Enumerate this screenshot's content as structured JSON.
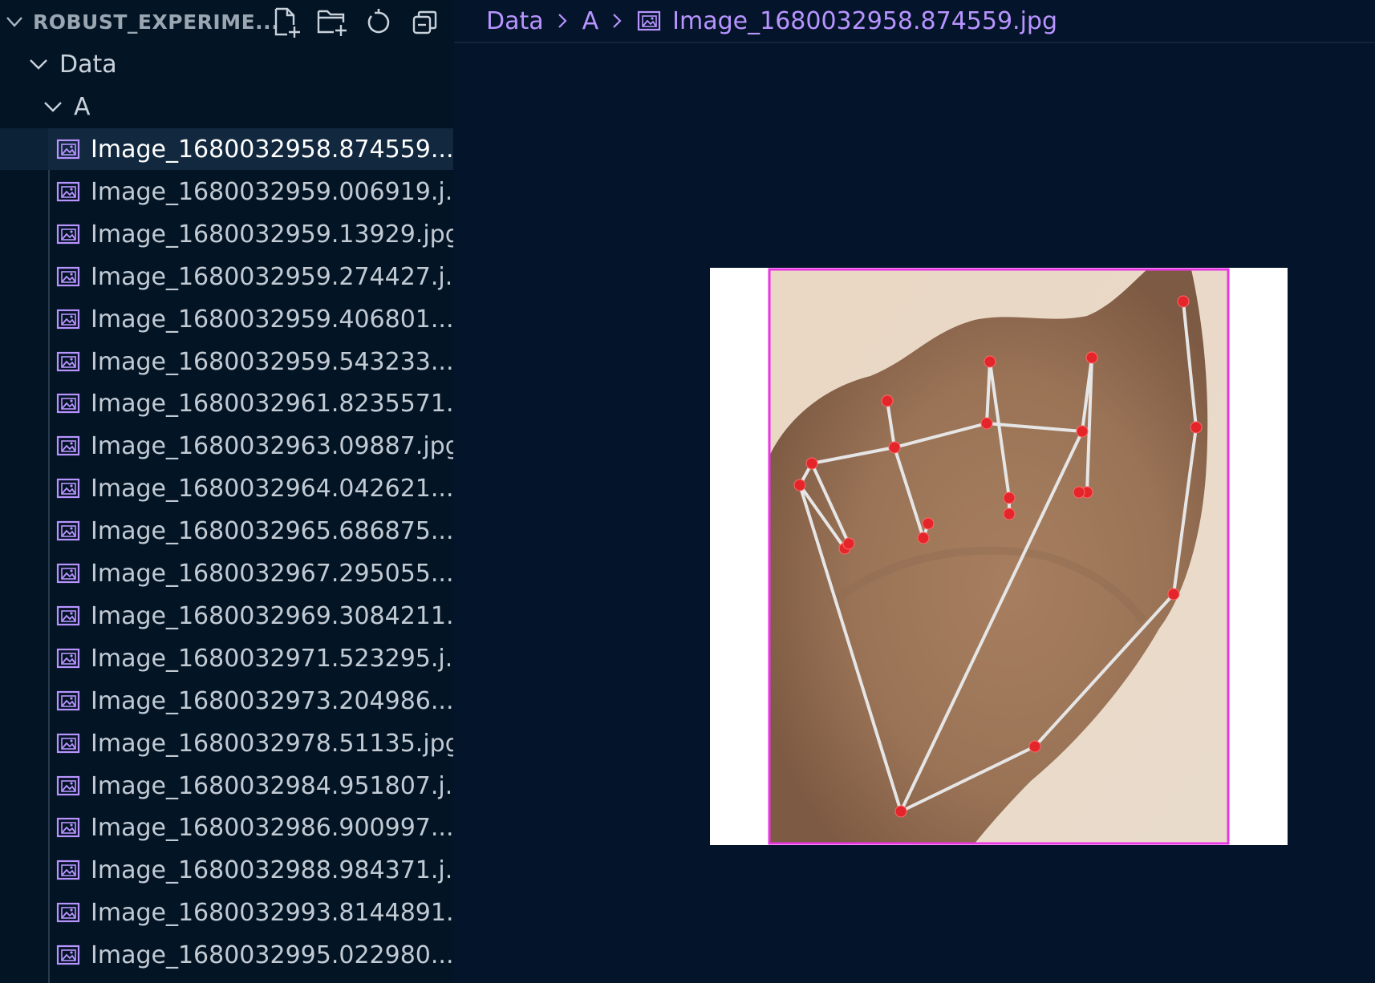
{
  "explorer": {
    "title": "ROBUST_EXPERIME...",
    "actions": [
      "new-file-icon",
      "new-folder-icon",
      "refresh-icon",
      "collapse-all-icon"
    ],
    "tree": {
      "root_folder": "Data",
      "sub_folder": "A",
      "files": [
        "Image_1680032958.874559....",
        "Image_1680032959.006919.j...",
        "Image_1680032959.13929.jpg",
        "Image_1680032959.274427.j...",
        "Image_1680032959.406801....",
        "Image_1680032959.543233....",
        "Image_1680032961.8235571...",
        "Image_1680032963.09887.jpg",
        "Image_1680032964.042621...",
        "Image_1680032965.686875...",
        "Image_1680032967.295055...",
        "Image_1680032969.3084211...",
        "Image_1680032971.523295.j...",
        "Image_1680032973.204986...",
        "Image_1680032978.51135.jpg",
        "Image_1680032984.951807.j...",
        "Image_1680032986.900997...",
        "Image_1680032988.984371.j...",
        "Image_1680032993.8144891...",
        "Image_1680032995.022980..."
      ],
      "selected_index": 0
    }
  },
  "editor": {
    "breadcrumb": [
      "Data",
      "A",
      "Image_1680032958.874559.jpg"
    ],
    "preview": {
      "subject": "hand sign with landmark overlay",
      "bbox_color": "#ea35e6",
      "landmark_color": "#e4262b",
      "connection_color": "#e6e6e6"
    }
  },
  "colors": {
    "sidebar_bg": "#031425",
    "editor_bg": "#04142a",
    "accent": "#b894ff",
    "selection": "#12283e"
  }
}
